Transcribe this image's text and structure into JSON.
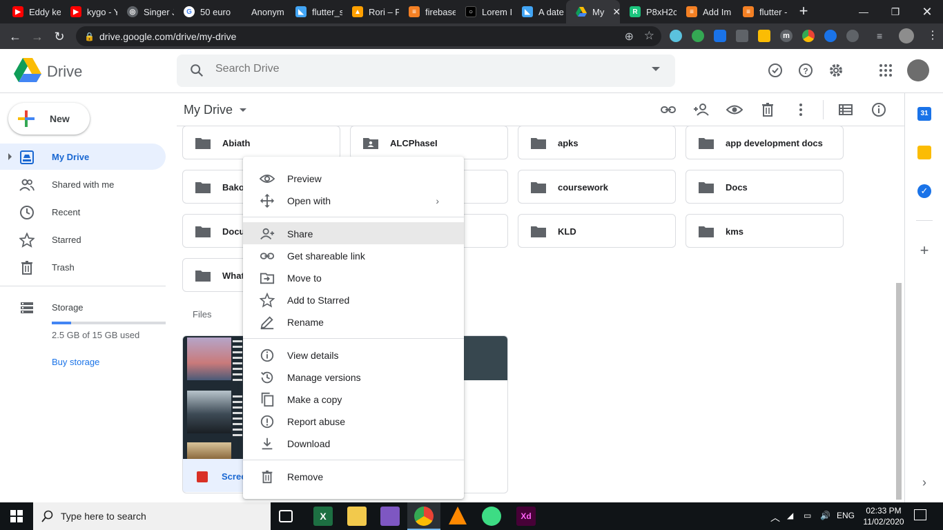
{
  "browser": {
    "tabs": [
      {
        "label": "Eddy ke",
        "favicon": "youtube-icon",
        "color": "#ff0000"
      },
      {
        "label": "kygo - Y",
        "favicon": "youtube-icon",
        "color": "#ff0000"
      },
      {
        "label": "Singer J",
        "favicon": "globe-icon",
        "color": "#5f6368"
      },
      {
        "label": "50 euro",
        "favicon": "google-icon",
        "color": "#4285f4"
      },
      {
        "label": "Anonym",
        "favicon": "blank-icon",
        "color": "#202124"
      },
      {
        "label": "flutter_s",
        "favicon": "flutter-icon",
        "color": "#42a5f5"
      },
      {
        "label": "Rori – F",
        "favicon": "firebase-icon",
        "color": "#ffa000"
      },
      {
        "label": "firebase",
        "favicon": "stackoverflow-icon",
        "color": "#f48024"
      },
      {
        "label": "Lorem I",
        "favicon": "lorem-icon",
        "color": "#000000"
      },
      {
        "label": "A date t",
        "favicon": "flutter-icon",
        "color": "#42a5f5"
      },
      {
        "label": "My",
        "favicon": "drive-icon",
        "color": "#34a853"
      },
      {
        "label": "P8xH2c",
        "favicon": "replit-icon",
        "color": "#1bc47d"
      },
      {
        "label": "Add Im",
        "favicon": "stackoverflow-icon",
        "color": "#f48024"
      },
      {
        "label": "flutter -",
        "favicon": "stackoverflow-icon",
        "color": "#f48024"
      }
    ],
    "url": "drive.google.com/drive/my-drive"
  },
  "drive": {
    "brand": "Drive",
    "search_placeholder": "Search Drive"
  },
  "sidebar": {
    "new_label": "New",
    "items": [
      {
        "label": "My Drive",
        "icon": "my-drive-icon"
      },
      {
        "label": "Shared with me",
        "icon": "shared-icon"
      },
      {
        "label": "Recent",
        "icon": "clock-icon"
      },
      {
        "label": "Starred",
        "icon": "star-icon"
      },
      {
        "label": "Trash",
        "icon": "trash-icon"
      },
      {
        "label": "Storage",
        "icon": "storage-icon"
      }
    ],
    "storage_used": "2.5 GB of 15 GB used",
    "storage_fraction": 0.167,
    "buy_storage": "Buy storage"
  },
  "main": {
    "breadcrumb": "My Drive",
    "folders": [
      {
        "name": "Abiath",
        "shared": false
      },
      {
        "name": "ALCPhaseI",
        "shared": true
      },
      {
        "name": "apks",
        "shared": false
      },
      {
        "name": "app development docs",
        "shared": false
      },
      {
        "name": "Bakol",
        "shared": false
      },
      {
        "name": "coursework",
        "shared": false
      },
      {
        "name": "Docs",
        "shared": false
      },
      {
        "name": "Docu",
        "shared": false
      },
      {
        "name": "KLD",
        "shared": false
      },
      {
        "name": "kms",
        "shared": false
      },
      {
        "name": "What",
        "shared": false
      }
    ],
    "files_label": "Files",
    "files": [
      {
        "name": "Scree"
      }
    ]
  },
  "context_menu": {
    "items": [
      {
        "label": "Preview",
        "icon": "eye-icon"
      },
      {
        "label": "Open with",
        "icon": "move-arrows-icon",
        "submenu": "›"
      },
      {
        "label": "Share",
        "icon": "person-add-icon"
      },
      {
        "label": "Get shareable link",
        "icon": "link-icon"
      },
      {
        "label": "Move to",
        "icon": "move-to-folder-icon"
      },
      {
        "label": "Add to Starred",
        "icon": "star-icon"
      },
      {
        "label": "Rename",
        "icon": "pencil-icon"
      },
      {
        "label": "View details",
        "icon": "info-icon"
      },
      {
        "label": "Manage versions",
        "icon": "history-icon"
      },
      {
        "label": "Make a copy",
        "icon": "copy-icon"
      },
      {
        "label": "Report abuse",
        "icon": "warning-icon"
      },
      {
        "label": "Download",
        "icon": "download-icon"
      },
      {
        "label": "Remove",
        "icon": "trash-icon"
      }
    ],
    "hovered": "Share"
  },
  "right_rail": {
    "calendar_day": "31"
  },
  "taskbar": {
    "search_placeholder": "Type here to search",
    "language": "ENG",
    "time": "02:33 PM",
    "date": "11/02/2020"
  }
}
